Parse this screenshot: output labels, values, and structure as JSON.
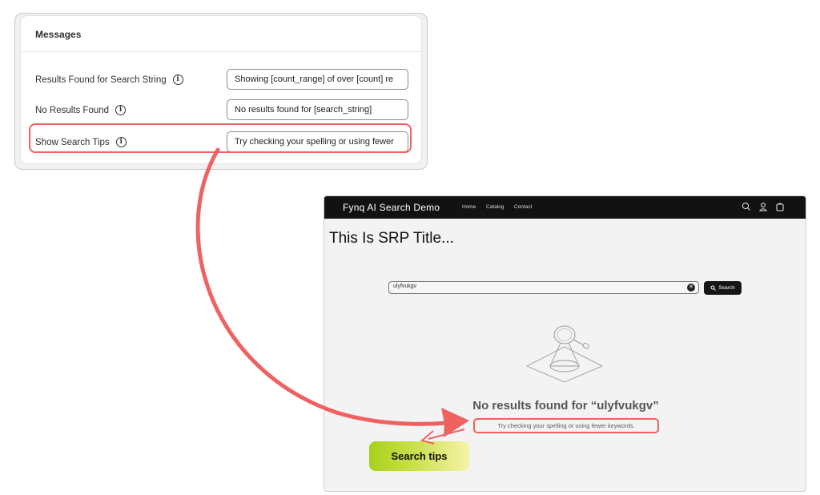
{
  "settings": {
    "title": "Messages",
    "rows": [
      {
        "label": "Results Found for Search String",
        "value": "Showing [count_range] of over [count] re"
      },
      {
        "label": "No Results Found",
        "value": "No results found for [search_string]"
      },
      {
        "label": "Show Search Tips",
        "value": "Try checking your spelling or using fewer"
      }
    ]
  },
  "store": {
    "brand": "Fynq AI Search Demo",
    "nav": [
      "Home",
      "Catalog",
      "Contact"
    ],
    "nav_icons": [
      "search-icon",
      "account-icon",
      "cart-icon"
    ],
    "page_title": "This Is SRP Title...",
    "search_value": "ulyfvukgv",
    "search_button": "Search",
    "no_results_heading": "No results found for “ulyfvukgv”",
    "tips_text": "Try checking your spelling or using fewer keywords."
  },
  "callout": {
    "label": "Search tips"
  },
  "colors": {
    "highlight": "#f06262",
    "nav_background": "#121212",
    "callout_gradient_start": "#a9d11b",
    "callout_gradient_end": "#f8f3a8"
  }
}
